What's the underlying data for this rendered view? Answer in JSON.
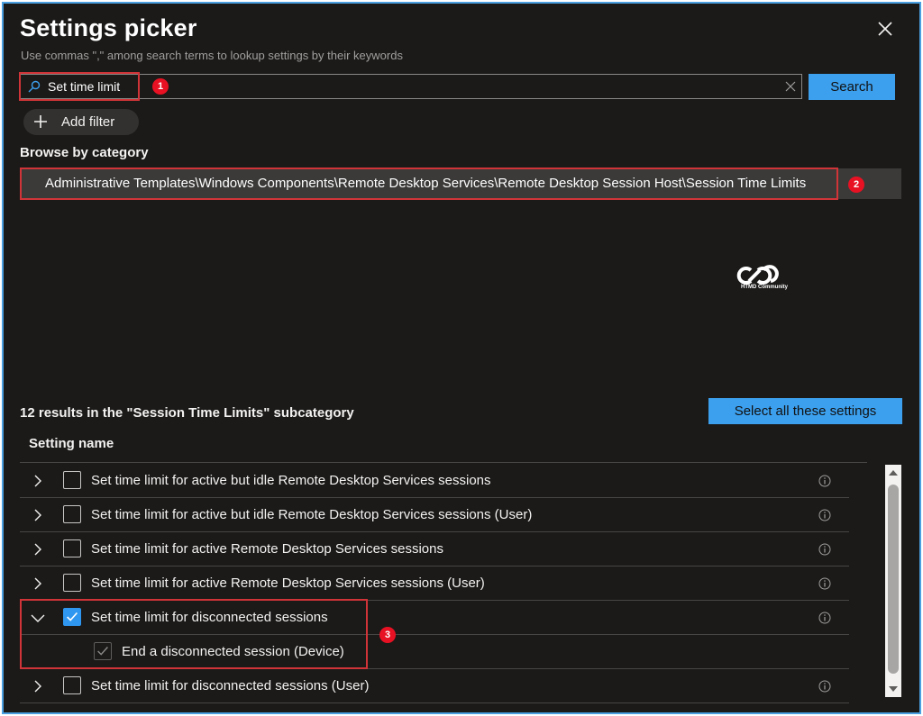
{
  "title": "Settings picker",
  "subtitle": "Use commas \",\" among search terms to lookup settings by their keywords",
  "search": {
    "value": "Set time limit",
    "button_label": "Search"
  },
  "add_filter_label": "Add filter",
  "browse": {
    "label": "Browse by category",
    "selected_path": "Administrative Templates\\Windows Components\\Remote Desktop Services\\Remote Desktop Session Host\\Session Time Limits"
  },
  "watermark": {
    "caption": "HTMD Community"
  },
  "results": {
    "count_text": "12 results in the \"Session Time Limits\" subcategory",
    "select_all_label": "Select all these settings",
    "column_header": "Setting name",
    "rows": [
      {
        "label": "Set time limit for active but idle Remote Desktop Services sessions",
        "checked": false,
        "expanded": false
      },
      {
        "label": "Set time limit for active but idle Remote Desktop Services sessions (User)",
        "checked": false,
        "expanded": false
      },
      {
        "label": "Set time limit for active Remote Desktop Services sessions",
        "checked": false,
        "expanded": false
      },
      {
        "label": "Set time limit for active Remote Desktop Services sessions (User)",
        "checked": false,
        "expanded": false
      },
      {
        "label": "Set time limit for disconnected sessions",
        "checked": true,
        "expanded": true
      },
      {
        "label": "End a disconnected session (Device)",
        "checked": true,
        "child": true,
        "disabled": true
      },
      {
        "label": "Set time limit for disconnected sessions (User)",
        "checked": false,
        "expanded": false
      }
    ]
  },
  "annotations": {
    "badge1": "1",
    "badge2": "2",
    "badge3": "3"
  },
  "colors": {
    "accent": "#3ca0ef",
    "background": "#1b1a19",
    "highlight_border": "#d13438",
    "badge": "#e81123",
    "frame_border": "#4a9fe0"
  },
  "icons": [
    "close-icon",
    "search-icon",
    "clear-icon",
    "plus-icon",
    "chevron-right-icon",
    "chevron-down-icon",
    "checkbox-icon",
    "info-icon",
    "scroll-up-icon",
    "scroll-down-icon"
  ]
}
